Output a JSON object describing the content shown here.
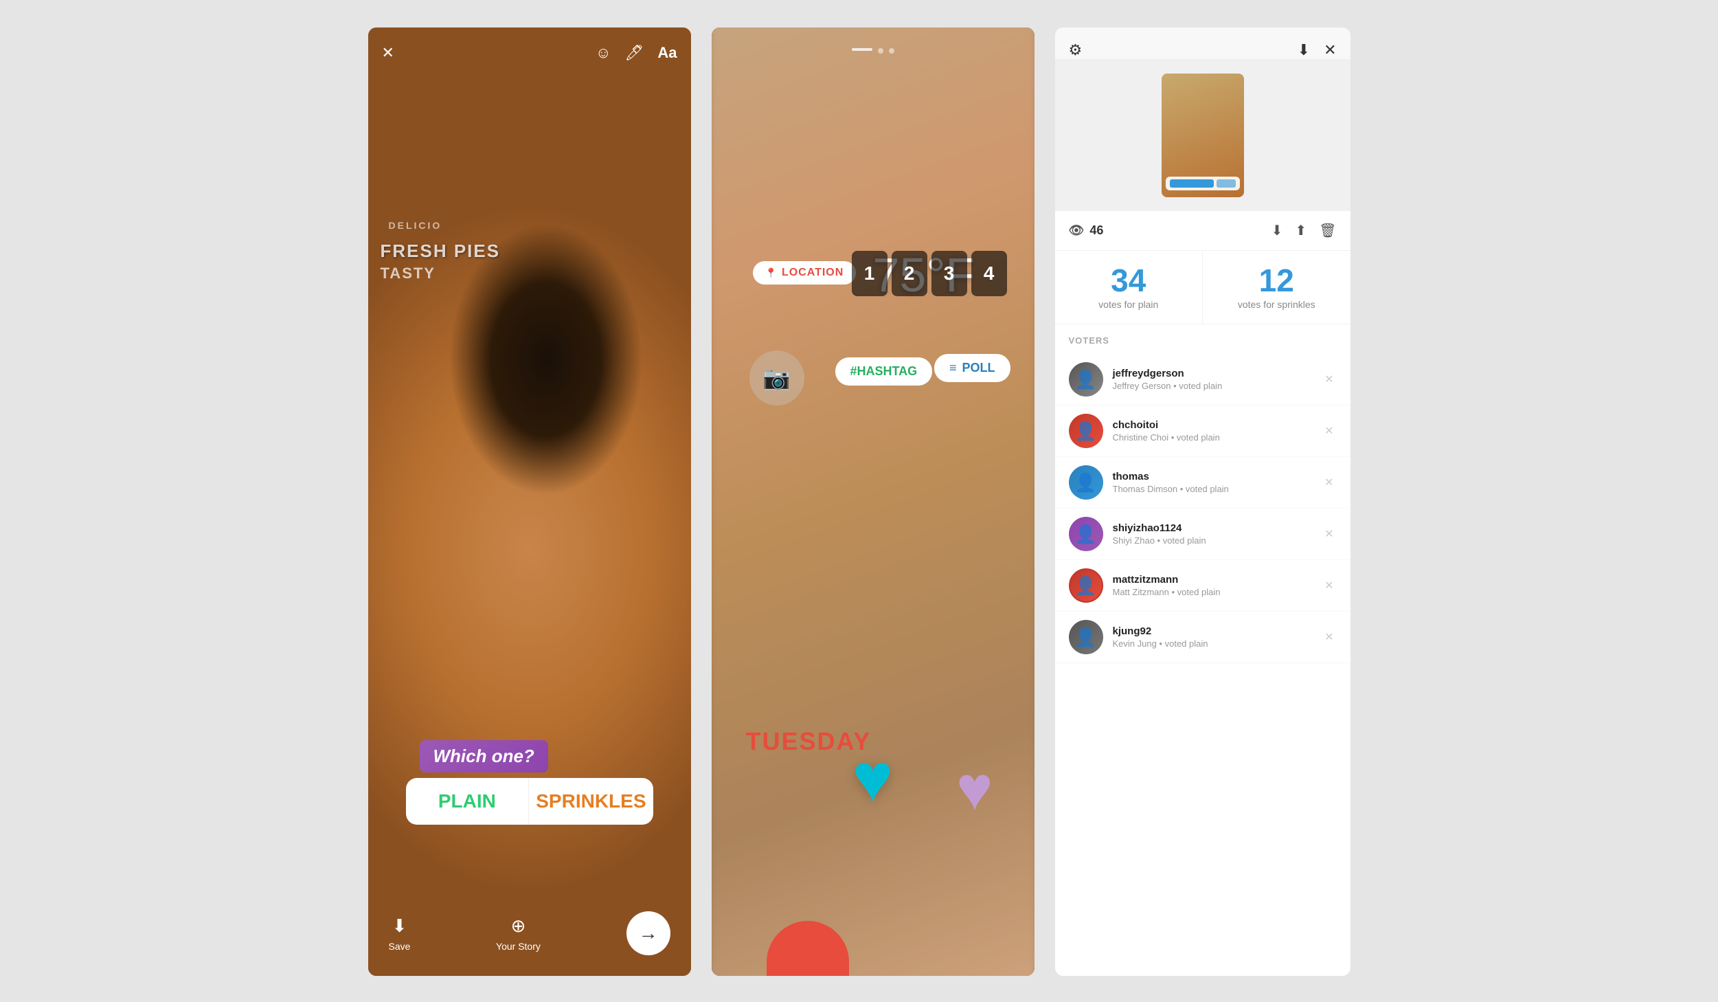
{
  "panel1": {
    "toolbar": {
      "close_icon": "✕",
      "face_icon": "☺",
      "brush_icon": "✏",
      "text_label": "Aa"
    },
    "store_signs": {
      "line1": "DELICIO",
      "line2": "FRESH PIES",
      "line3": "TASTY"
    },
    "poll": {
      "question": "Which one?",
      "option1": "PLAIN",
      "option2": "SPRINKLES"
    },
    "bottom": {
      "save_label": "Save",
      "story_label": "Your Story"
    }
  },
  "panel2": {
    "location_text": "LOCATION",
    "temperature": "75°F",
    "timer_digits": [
      "1",
      "2",
      "3",
      "4"
    ],
    "hashtag_text": "#HASHTAG",
    "poll_text": "POLL",
    "tuesday_text": "TUESDAY"
  },
  "panel3": {
    "views_count": "46",
    "votes": {
      "plain_count": "34",
      "plain_label": "votes for plain",
      "sprinkles_count": "12",
      "sprinkles_label": "votes for sprinkles"
    },
    "voters_title": "VOTERS",
    "voters": [
      {
        "username": "jeffreydgerson",
        "detail": "Jeffrey Gerson • voted plain",
        "avatar_class": "av1"
      },
      {
        "username": "chchoitoi",
        "detail": "Christine Choi • voted plain",
        "avatar_class": "av2"
      },
      {
        "username": "thomas",
        "detail": "Thomas Dimson • voted plain",
        "avatar_class": "av3"
      },
      {
        "username": "shiyizhao1124",
        "detail": "Shiyi Zhao • voted plain",
        "avatar_class": "av4"
      },
      {
        "username": "mattzitzmann",
        "detail": "Matt Zitzmann • voted plain",
        "avatar_class": "av5"
      },
      {
        "username": "kjung92",
        "detail": "Kevin Jung • voted plain",
        "avatar_class": "av6"
      }
    ]
  }
}
